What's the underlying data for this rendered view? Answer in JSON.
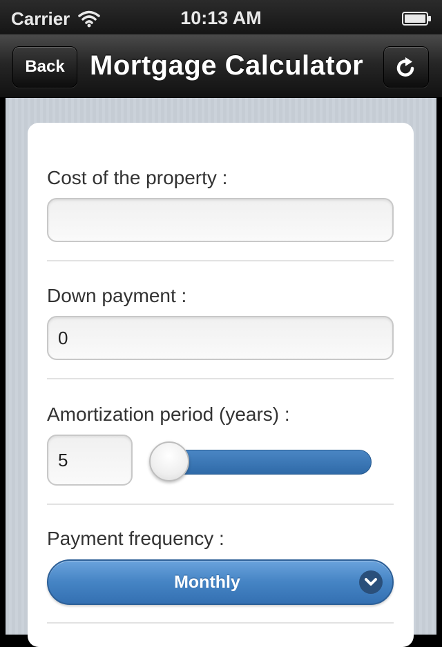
{
  "status_bar": {
    "carrier": "Carrier",
    "time": "10:13 AM",
    "wifi_icon": "wifi-icon",
    "battery_icon": "battery-icon"
  },
  "nav_bar": {
    "back_label": "Back",
    "title": "Mortgage Calculator",
    "refresh_icon": "refresh-icon"
  },
  "form": {
    "cost": {
      "label": "Cost of the property :",
      "value": ""
    },
    "down_payment": {
      "label": "Down payment :",
      "value": "0"
    },
    "amortization": {
      "label": "Amortization period (years) :",
      "value": "5",
      "slider_level": 0.0
    },
    "payment_frequency": {
      "label": "Payment frequency :",
      "selected": "Monthly"
    }
  },
  "colors": {
    "accent": "#4584c4",
    "nav_bg": "#262626",
    "page_bg": "#c5ccd4"
  }
}
